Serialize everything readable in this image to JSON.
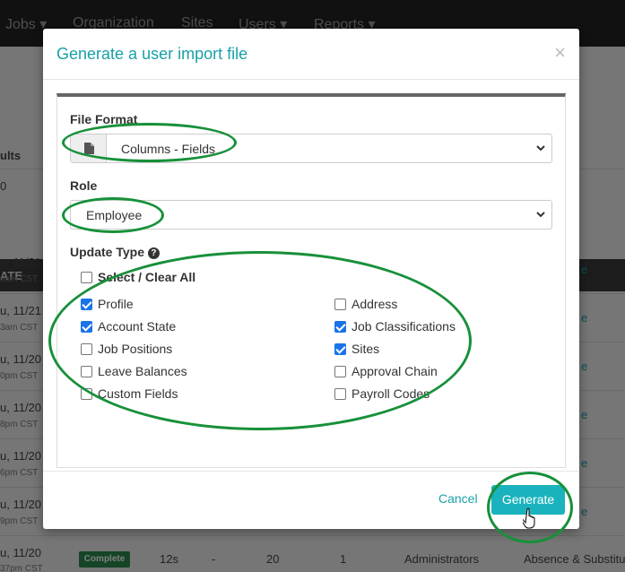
{
  "nav": {
    "jobs": "Jobs",
    "organization": "Organization",
    "sites": "Sites",
    "users": "Users",
    "reports": "Reports"
  },
  "background": {
    "col_header_fragment": "ults",
    "col_value_fragment": "0",
    "table_header_fragment": "ATE",
    "rows": [
      {
        "date": "u, 11/21",
        "time": "6am CST",
        "link": "e"
      },
      {
        "date": "u, 11/21",
        "time": "3am CST",
        "link": "e"
      },
      {
        "date": "u, 11/20",
        "time": "0pm CST",
        "link": "e"
      },
      {
        "date": "u, 11/20",
        "time": "8pm CST",
        "link": "e"
      },
      {
        "date": "u, 11/20",
        "time": "6pm CST",
        "link": "e"
      },
      {
        "date": "u, 11/20",
        "time": "9pm CST",
        "link": "e"
      }
    ],
    "last_row": {
      "date": "u, 11/20",
      "time": "37pm CST",
      "status": "Complete",
      "duration": "12s",
      "dash": "-",
      "count": "20",
      "count2": "1",
      "group": "Administrators",
      "type": "Absence & Substitu"
    }
  },
  "modal": {
    "title": "Generate a user import file",
    "close": "×",
    "file_format": {
      "label": "File Format",
      "value": "Columns - Fields",
      "icon": "file-icon"
    },
    "role": {
      "label": "Role",
      "value": "Employee"
    },
    "update_type": {
      "label": "Update Type",
      "help_icon": "?",
      "select_all": "Select / Clear All",
      "options": [
        {
          "label": "Profile",
          "checked": true
        },
        {
          "label": "Address",
          "checked": false
        },
        {
          "label": "Account State",
          "checked": true
        },
        {
          "label": "Job Classifications",
          "checked": true
        },
        {
          "label": "Job Positions",
          "checked": false
        },
        {
          "label": "Sites",
          "checked": true
        },
        {
          "label": "Leave Balances",
          "checked": false
        },
        {
          "label": "Approval Chain",
          "checked": false
        },
        {
          "label": "Custom Fields",
          "checked": false
        },
        {
          "label": "Payroll Codes",
          "checked": false
        }
      ]
    },
    "cancel": "Cancel",
    "generate": "Generate"
  },
  "colors": {
    "accent": "#18a0a8",
    "button": "#1ab3bd",
    "annotation": "#17903a",
    "checkbox": "#1a73e8"
  }
}
